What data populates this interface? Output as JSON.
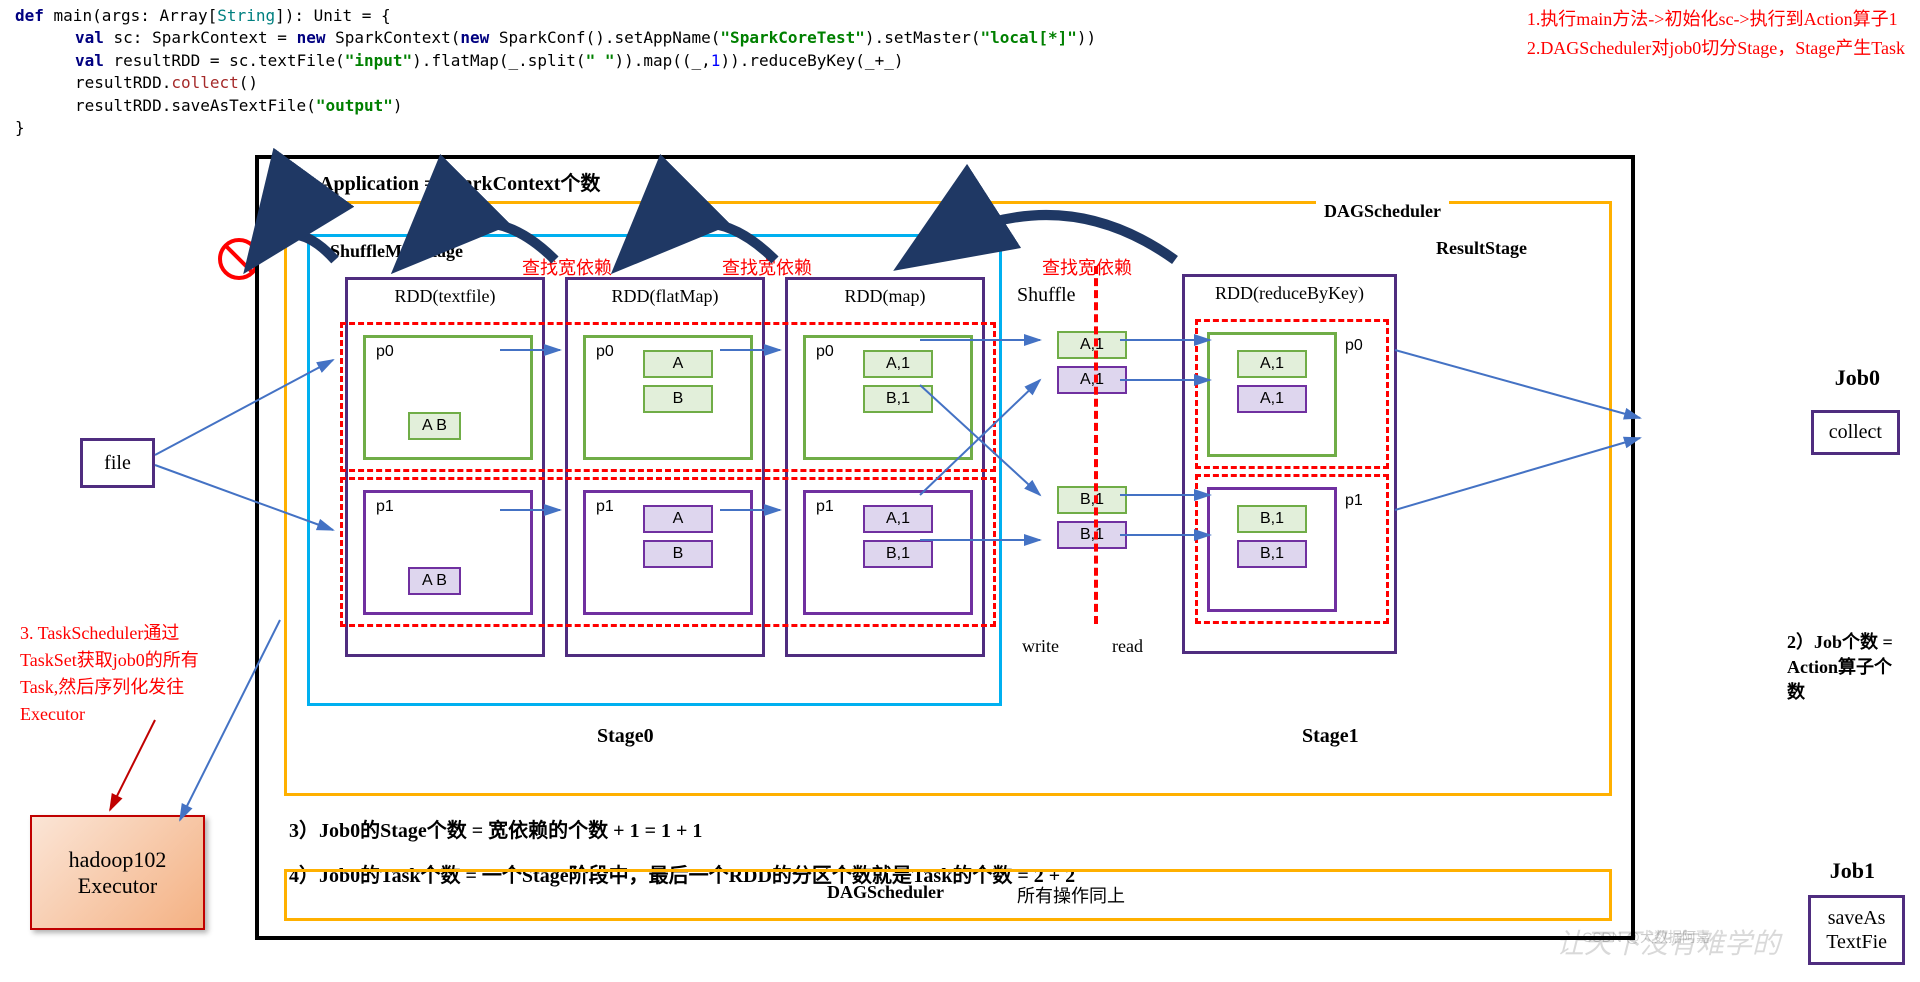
{
  "code": {
    "line1_def": "def",
    "line1_main": " main(args: Array[",
    "line1_string": "String",
    "line1_end": "]): Unit = {",
    "line2_val": "val",
    "line2_sc": " sc: SparkContext = ",
    "line2_new": "new",
    "line2_rest": " SparkContext(",
    "line2_new2": "new",
    "line2_conf": " SparkConf().setAppName(",
    "line2_str1": "\"SparkCoreTest\"",
    "line2_mid": ").setMaster(",
    "line2_str2": "\"local[*]\"",
    "line2_end": "))",
    "line3_val": "val",
    "line3_a": " resultRDD = sc.textFile(",
    "line3_str1": "\"input\"",
    "line3_b": ").flatMap(_.split(",
    "line3_str2": "\" \"",
    "line3_c": ")).map((_,",
    "line3_num": "1",
    "line3_d": ")).reduceByKey(_+_)",
    "line4_a": "resultRDD.",
    "line4_collect": "collect",
    "line4_b": "()",
    "line5_a": "resultRDD.saveAsTextFile(",
    "line5_str": "\"output\"",
    "line5_b": ")",
    "line6": "}"
  },
  "notes": {
    "top1": "1.执行main方法->初始化sc->执行到Action算子1",
    "top2": "2.DAGScheduler对job0切分Stage，Stage产生Task",
    "side3": "3. TaskScheduler通过TaskSet获取job0的所有Task,然后序列化发往Executor",
    "right2": "2）Job个数 = Action算子个数"
  },
  "titles": {
    "app": "1）Application = SparkContext个数",
    "dag": "DAGScheduler",
    "shuffle_stage": "ShuffleMapStage",
    "result_stage": "ResultStage",
    "stage0": "Stage0",
    "stage1": "Stage1",
    "shuffle": "Shuffle",
    "write": "write",
    "read": "read",
    "note3": "3）Job0的Stage个数 = 宽依赖的个数 + 1 = 1 + 1",
    "note4": "4）Job0的Task个数 = 一个Stage阶段中，最后一个RDD的分区个数就是Task的个数 = 2 + 2",
    "dag2": "DAGScheduler",
    "all_same": "所有操作同上"
  },
  "wide_dep": "查找宽依赖",
  "rdds": {
    "textfile": "RDD(textfile)",
    "flatmap": "RDD(flatMap)",
    "map": "RDD(map)",
    "reduce": "RDD(reduceByKey)"
  },
  "partitions": {
    "p0": "p0",
    "p1": "p1",
    "ab": "A B",
    "a": "A",
    "b": "B",
    "a1": "A,1",
    "b1": "B,1"
  },
  "file": "file",
  "executor": {
    "host": "hadoop102",
    "label": "Executor"
  },
  "jobs": {
    "job0": "Job0",
    "job1": "Job1",
    "collect": "collect",
    "save": "saveAs\nTextFie"
  },
  "watermark": "让天下没有难学的",
  "csdn": "CSDN @大数据阿嘉"
}
